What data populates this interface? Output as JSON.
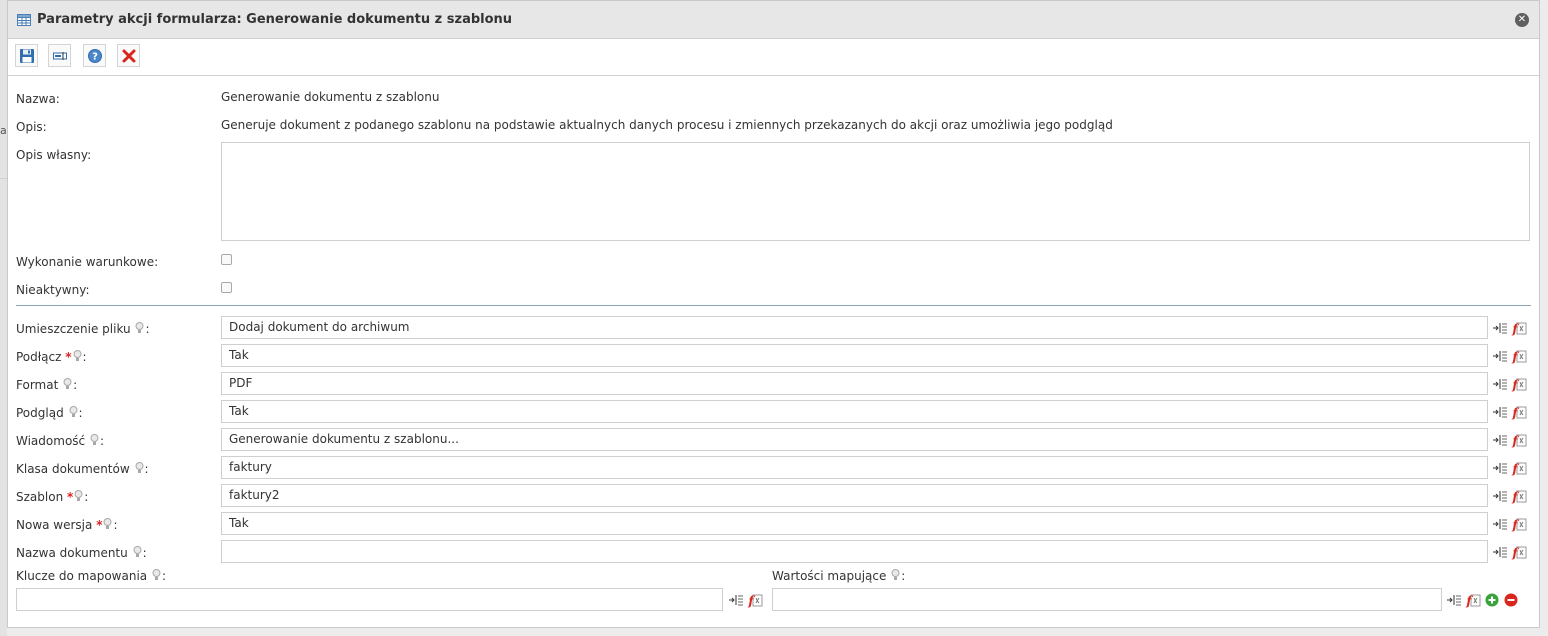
{
  "background": {
    "letter": "a"
  },
  "dialog": {
    "title": "Parametry akcji formularza: Generowanie dokumentu z szablonu"
  },
  "info": {
    "name_label": "Nazwa:",
    "name_value": "Generowanie dokumentu z szablonu",
    "desc_label": "Opis:",
    "desc_value": "Generuje dokument z podanego szablonu na podstawie aktualnych danych procesu i zmiennych przekazanych do akcji oraz umożliwia jego podgląd",
    "own_desc_label": "Opis własny:",
    "own_desc_value": "",
    "conditional_label": "Wykonanie warunkowe:",
    "inactive_label": "Nieaktywny:"
  },
  "params": [
    {
      "label": "Umieszczenie pliku",
      "required": false,
      "value": "Dodaj dokument do archiwum"
    },
    {
      "label": "Podłącz",
      "required": true,
      "value": "Tak"
    },
    {
      "label": "Format",
      "required": false,
      "value": "PDF"
    },
    {
      "label": "Podgląd",
      "required": false,
      "value": "Tak"
    },
    {
      "label": "Wiadomość",
      "required": false,
      "value": "Generowanie dokumentu z szablonu..."
    },
    {
      "label": "Klasa dokumentów",
      "required": false,
      "value": "faktury"
    },
    {
      "label": "Szablon",
      "required": true,
      "value": "faktury2"
    },
    {
      "label": "Nowa wersja",
      "required": true,
      "value": "Tak"
    },
    {
      "label": "Nazwa dokumentu",
      "required": false,
      "value": ""
    }
  ],
  "mapping": {
    "keys_label": "Klucze do mapowania",
    "values_label": "Wartości mapujące",
    "keys_value": "",
    "values_value": ""
  },
  "symbols": {
    "colon": ":",
    "required_mark": "*"
  },
  "colors": {
    "accent": "#2f6fb0",
    "danger": "#d9261c",
    "add": "#3aa23a",
    "remove": "#d9261c"
  }
}
